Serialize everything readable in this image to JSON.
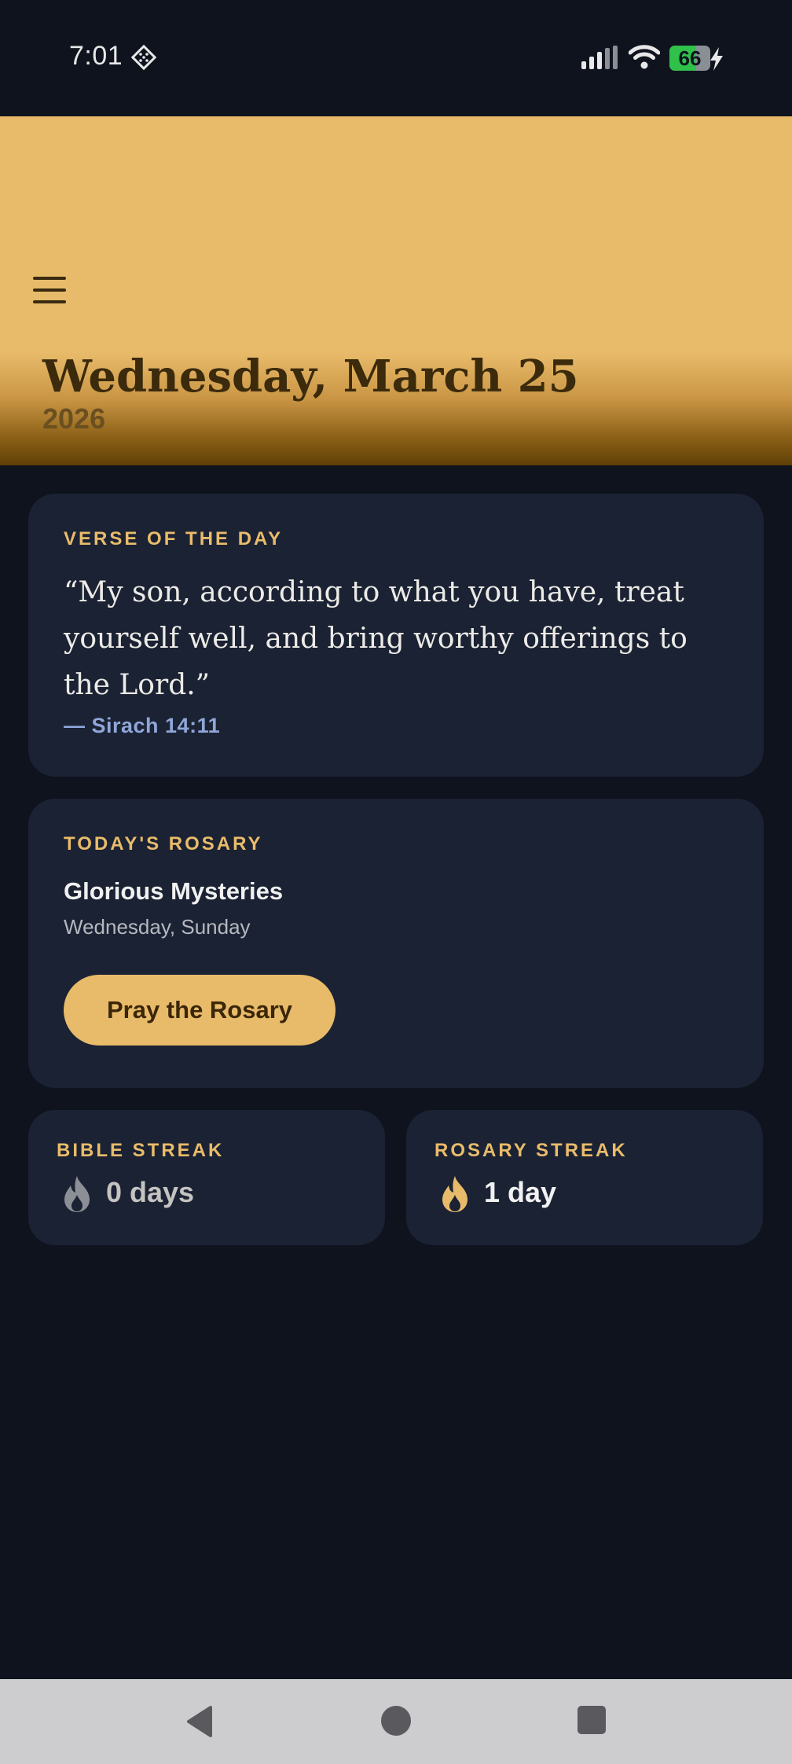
{
  "status_bar": {
    "time": "7:01",
    "battery_level": "66",
    "battery_fraction": 0.66,
    "icons": [
      "notification-diamond-icon",
      "signal-icon",
      "wifi-icon",
      "battery-icon",
      "charging-bolt-icon"
    ]
  },
  "header": {
    "menu_icon": "hamburger-menu-icon",
    "date": "Wednesday, March 25",
    "year": "2026"
  },
  "verse_card": {
    "label": "VERSE OF THE DAY",
    "text": "“My son, according to what you have, treat yourself well, and bring worthy offerings to the Lord.”",
    "reference": "— Sirach 14:11"
  },
  "rosary_card": {
    "label": "TODAY'S ROSARY",
    "mysteries": "Glorious Mysteries",
    "days": "Wednesday, Sunday",
    "button_label": "Pray the Rosary"
  },
  "streaks": {
    "bible": {
      "label": "BIBLE STREAK",
      "value": "0 days",
      "icon": "flame-icon",
      "active": false
    },
    "rosary": {
      "label": "ROSARY STREAK",
      "value": "1 day",
      "icon": "flame-icon",
      "active": true
    }
  },
  "colors": {
    "background": "#0e131e",
    "card": "#1b2234",
    "accent_gold": "#e8bb6a",
    "reference_blue": "#8fa6d8"
  },
  "nav_bar": {
    "icons": [
      "back-icon",
      "home-icon",
      "recents-icon"
    ]
  }
}
